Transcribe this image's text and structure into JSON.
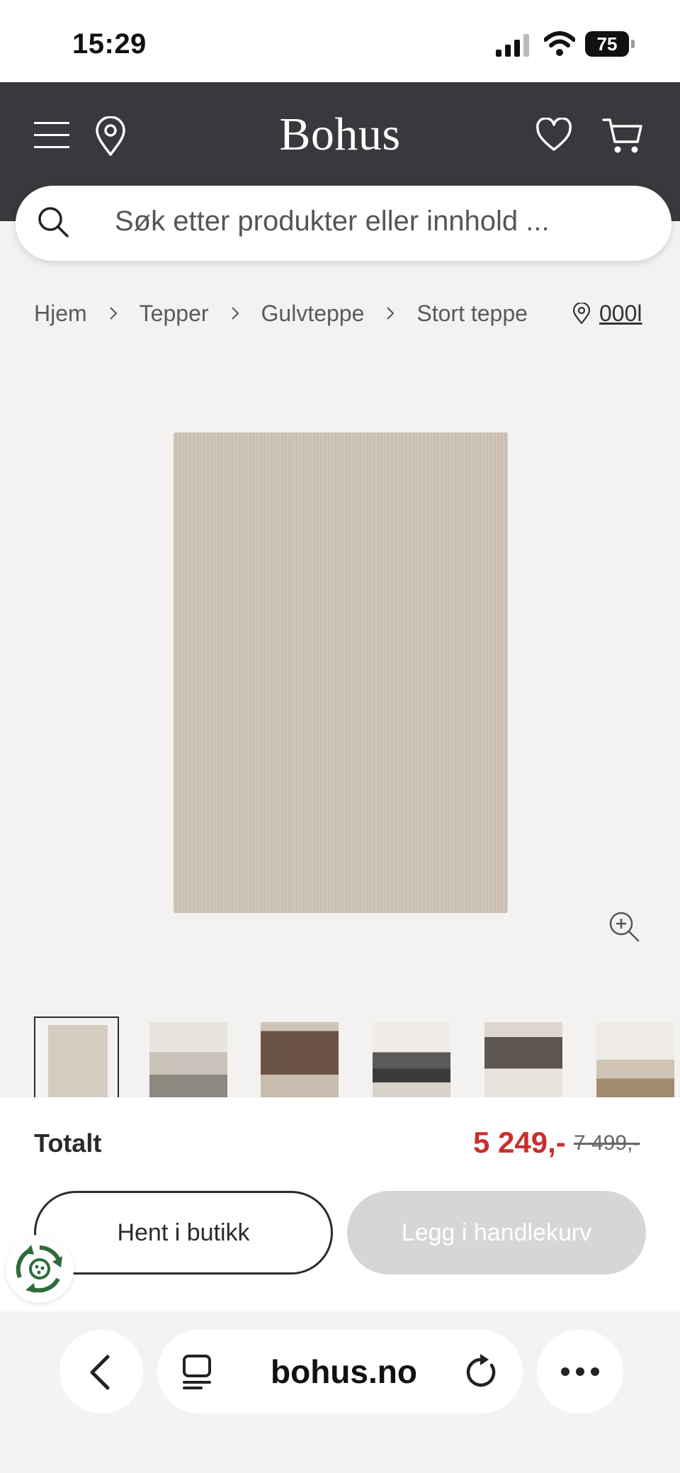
{
  "status_bar": {
    "time": "15:29",
    "battery": "75"
  },
  "header": {
    "logo": "Bohus",
    "colors": {
      "header_bg": "#38383d",
      "accent_price": "#c8302d"
    }
  },
  "search": {
    "placeholder": "Søk etter produkter eller innhold ..."
  },
  "breadcrumb": {
    "items": [
      "Hjem",
      "Tepper",
      "Gulvteppe",
      "Stort teppe"
    ]
  },
  "store": {
    "code": "000l"
  },
  "gallery": {
    "thumbnail_count": 6,
    "active_index": 0
  },
  "purchase": {
    "total_label": "Totalt",
    "price": "5 249,-",
    "old_price": "7 499,-",
    "pickup_button": "Hent i butikk",
    "add_to_cart_button": "Legg i handlekurv"
  },
  "browser": {
    "url": "bohus.no"
  }
}
